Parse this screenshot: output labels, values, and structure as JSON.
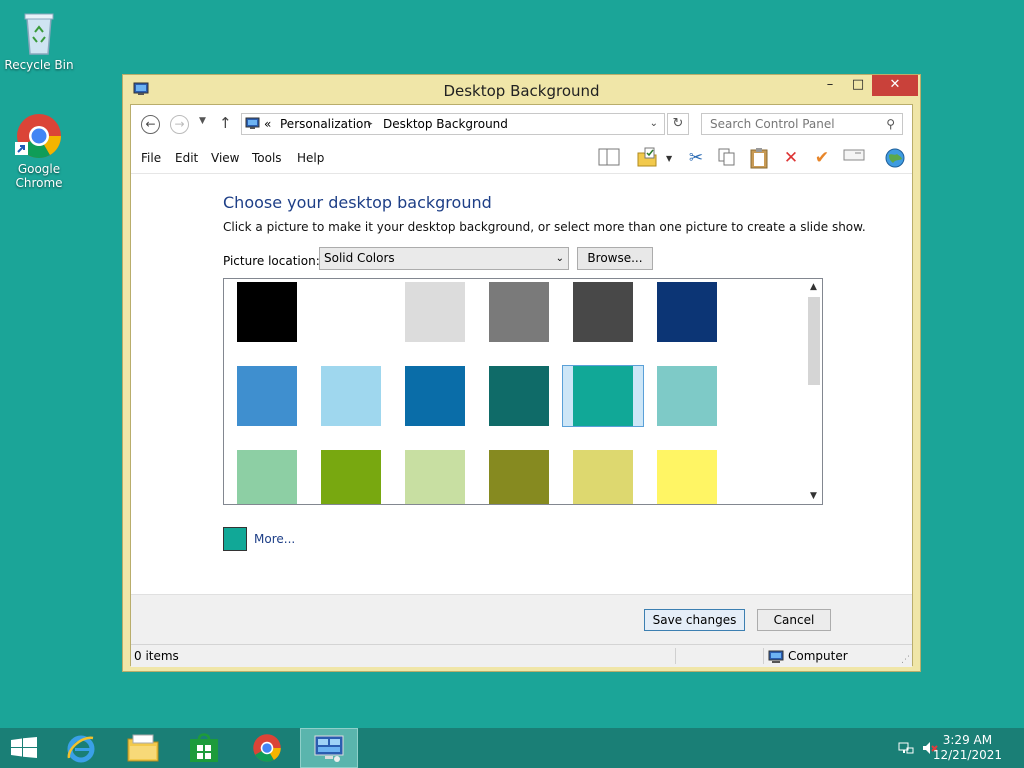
{
  "desktop": {
    "icons": [
      {
        "label": "Recycle Bin",
        "icon": "recycle-bin-icon"
      },
      {
        "label": "Google Chrome",
        "icon": "chrome-icon"
      }
    ],
    "background_color": "#1ba598"
  },
  "window": {
    "title": "Desktop Background",
    "controls": {
      "minimize": "–",
      "maximize": "□",
      "close": "✕"
    },
    "address": {
      "overflow": "«",
      "crumbs": [
        "Personalization",
        "Desktop Background"
      ],
      "separator": "▸"
    },
    "search": {
      "placeholder": "Search Control Panel"
    },
    "menu": [
      "File",
      "Edit",
      "View",
      "Tools",
      "Help"
    ],
    "heading": "Choose your desktop background",
    "subtext": "Click a picture to make it your desktop background, or select more than one picture to create a slide show.",
    "picture_location": {
      "label": "Picture location:",
      "value": "Solid Colors"
    },
    "browse_label": "Browse...",
    "swatches": [
      {
        "color": "#000000"
      },
      {
        "color": "#ffffff"
      },
      {
        "color": "#dcdcdc"
      },
      {
        "color": "#7a7a7a"
      },
      {
        "color": "#484848"
      },
      {
        "color": "#0c3575"
      },
      {
        "color": "#3f8fcf"
      },
      {
        "color": "#9fd7ee"
      },
      {
        "color": "#0a6da8"
      },
      {
        "color": "#0f6b68"
      },
      {
        "color": "#11a897",
        "selected": true
      },
      {
        "color": "#7ecac7"
      },
      {
        "color": "#8dcfa4"
      },
      {
        "color": "#78a810"
      },
      {
        "color": "#c8dfa2"
      },
      {
        "color": "#868a20"
      },
      {
        "color": "#ddd86f"
      },
      {
        "color": "#fff564"
      }
    ],
    "more": {
      "label": "More...",
      "color": "#11a897"
    },
    "buttons": {
      "save": "Save changes",
      "cancel": "Cancel"
    },
    "status": {
      "items": "0 items",
      "location": "Computer"
    }
  },
  "taskbar": {
    "apps": [
      "windows-start-icon",
      "internet-explorer-icon",
      "file-explorer-icon",
      "store-icon",
      "chrome-icon",
      "control-panel-icon"
    ],
    "time": "3:29 AM",
    "date": "12/21/2021"
  }
}
